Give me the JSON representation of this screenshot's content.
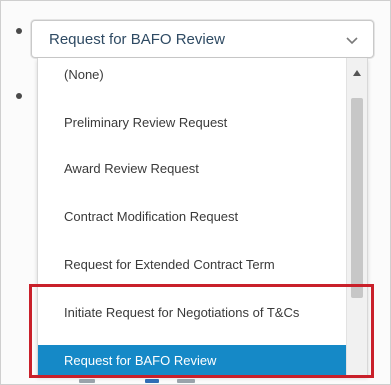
{
  "picklist": {
    "selected_value": "Request for BAFO Review",
    "options": [
      "(None)",
      "Preliminary Review Request",
      "Award Review Request",
      "Contract Modification Request",
      "Request for Extended Contract Term",
      "Initiate Request for Negotiations of T&Cs",
      "Request for BAFO Review"
    ],
    "highlighted_option_index": 6
  },
  "colors": {
    "selected_option_bg": "#1589c7",
    "annotation_border": "#c9202a"
  },
  "icons": {
    "dropdown": "chevron-down-icon",
    "scroll_up": "scroll-up-arrow-icon"
  }
}
